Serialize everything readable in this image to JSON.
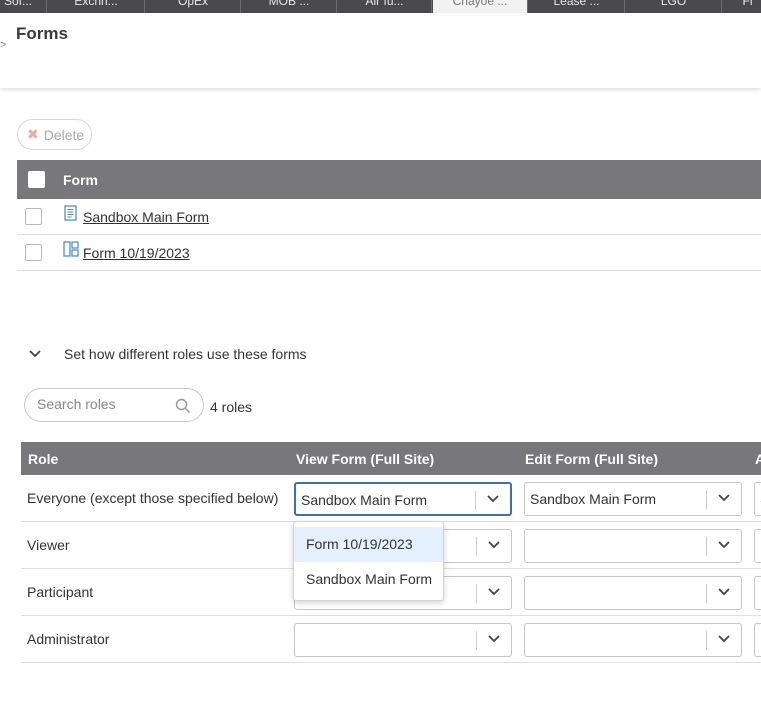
{
  "tabs": [
    {
      "label": "Sof..."
    },
    {
      "label": "Exchn..."
    },
    {
      "label": "OpEx"
    },
    {
      "label": "MOB ..."
    },
    {
      "label": "Air fu..."
    },
    {
      "label": "Chayoe ..."
    },
    {
      "label": "Lease ..."
    },
    {
      "label": "LGO"
    },
    {
      "label": "Fi"
    }
  ],
  "header": {
    "crumb": ">",
    "title": "Forms"
  },
  "delete": {
    "label": "Delete",
    "icon": "close-icon"
  },
  "forms_table": {
    "column": "Form",
    "rows": [
      {
        "name": "Sandbox Main Form",
        "icon": "document-icon"
      },
      {
        "name": "Form 10/19/2023",
        "icon": "layout-icon"
      }
    ]
  },
  "roles_section": {
    "toggle_label": "Set how different roles use these forms",
    "search_placeholder": "Search roles",
    "count": "4 roles",
    "columns": [
      "Role",
      "View Form (Full Site)",
      "Edit Form (Full Site)",
      "A"
    ],
    "rows": [
      {
        "role": "Everyone (except those specified below)",
        "view": "Sandbox Main Form",
        "edit": "Sandbox Main Form",
        "extra": "S"
      },
      {
        "role": "Viewer",
        "view": "",
        "edit": "",
        "extra": ""
      },
      {
        "role": "Participant",
        "view": "",
        "edit": "",
        "extra": ""
      },
      {
        "role": "Administrator",
        "view": "",
        "edit": "",
        "extra": ""
      }
    ]
  },
  "dropdown": {
    "options": [
      "Form 10/19/2023",
      "Sandbox Main Form"
    ],
    "highlighted": "Form 10/19/2023"
  },
  "colors": {
    "header_bg": "#78777c",
    "focus": "#3b6fb6",
    "highlight": "#e5f0ff"
  }
}
